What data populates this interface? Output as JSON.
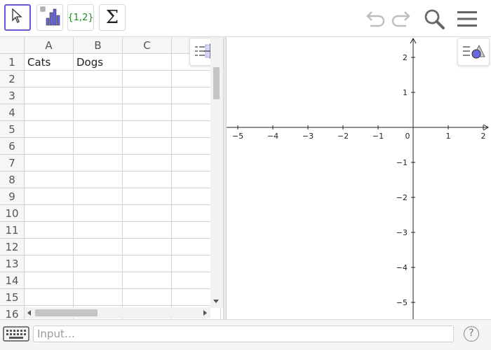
{
  "toolbar": {
    "tools": [
      {
        "id": "move",
        "icon": "cursor-arrow-icon",
        "selected": true
      },
      {
        "id": "histogram",
        "icon": "bar-chart-icon",
        "selected": false
      },
      {
        "id": "list",
        "icon": "list-icon",
        "label": "{1,2}",
        "selected": false
      },
      {
        "id": "sum",
        "icon": "sigma-icon",
        "label": "Σ",
        "selected": false
      }
    ],
    "right_icons": [
      "undo-icon",
      "redo-icon",
      "search-icon",
      "menu-icon"
    ]
  },
  "spreadsheet": {
    "columns": [
      "A",
      "B",
      "C"
    ],
    "rows": [
      "1",
      "2",
      "3",
      "4",
      "5",
      "6",
      "7",
      "8",
      "9",
      "10",
      "11",
      "12",
      "13",
      "14",
      "15",
      "16"
    ],
    "cells": {
      "A1": "Cats",
      "B1": "Dogs"
    }
  },
  "graphics": {
    "x_ticks": [
      "−5",
      "−4",
      "−3",
      "−2",
      "−1",
      "0",
      "1",
      "2"
    ],
    "y_ticks_pos": [
      "2",
      "1"
    ],
    "y_ticks_neg": [
      "−1",
      "−2",
      "−3",
      "−4",
      "−5"
    ]
  },
  "input_bar": {
    "placeholder": "Input…",
    "help_label": "?"
  },
  "colors": {
    "selected_tool": "#6557d2",
    "list_text": "#1b8a1b",
    "chart_bar": "#6666dd"
  }
}
